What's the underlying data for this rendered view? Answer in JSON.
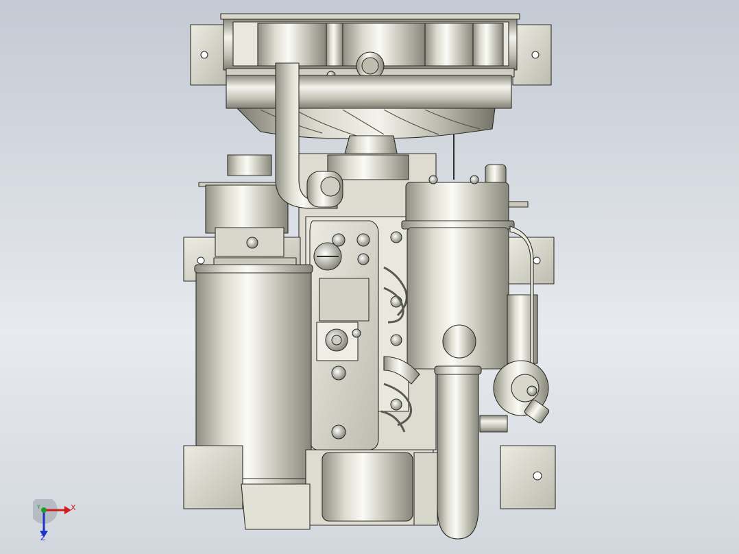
{
  "viewport": {
    "background_top": "#c4cad3",
    "background_bottom": "#e7eaee",
    "model": "engine-assembly"
  },
  "triad": {
    "x_label": "X",
    "y_label": "Y",
    "z_label": "Z",
    "x_color": "#d31c1c",
    "y_color": "#1f9d2a",
    "z_color": "#1c33c9"
  },
  "colors": {
    "metal_light": "#f2f2ea",
    "metal_mid": "#c9c9bc",
    "metal_dark": "#8d8d80",
    "edge": "#2d2d28"
  }
}
